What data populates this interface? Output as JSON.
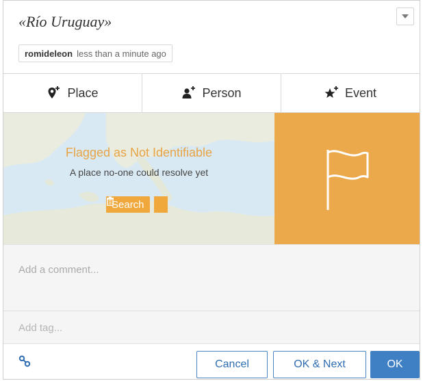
{
  "header": {
    "title": "«Río Uruguay»",
    "author": "romideleon",
    "timestamp": "less than a minute ago"
  },
  "tabs": [
    {
      "label": "Place",
      "icon": "map-pin-plus-icon"
    },
    {
      "label": "Person",
      "icon": "person-plus-icon"
    },
    {
      "label": "Event",
      "icon": "star-plus-icon"
    }
  ],
  "status": {
    "title": "Flagged as Not Identifiable",
    "subtitle": "A place no-one could resolve yet",
    "search_label": "Search"
  },
  "comment": {
    "placeholder": "Add a comment..."
  },
  "tags": {
    "placeholder": "Add tag..."
  },
  "footer": {
    "cancel_label": "Cancel",
    "ok_next_label": "OK & Next",
    "ok_label": "OK"
  },
  "colors": {
    "accent_orange": "#eca94b",
    "primary_blue": "#3f7fc4",
    "map_water": "#d9e9f3"
  }
}
